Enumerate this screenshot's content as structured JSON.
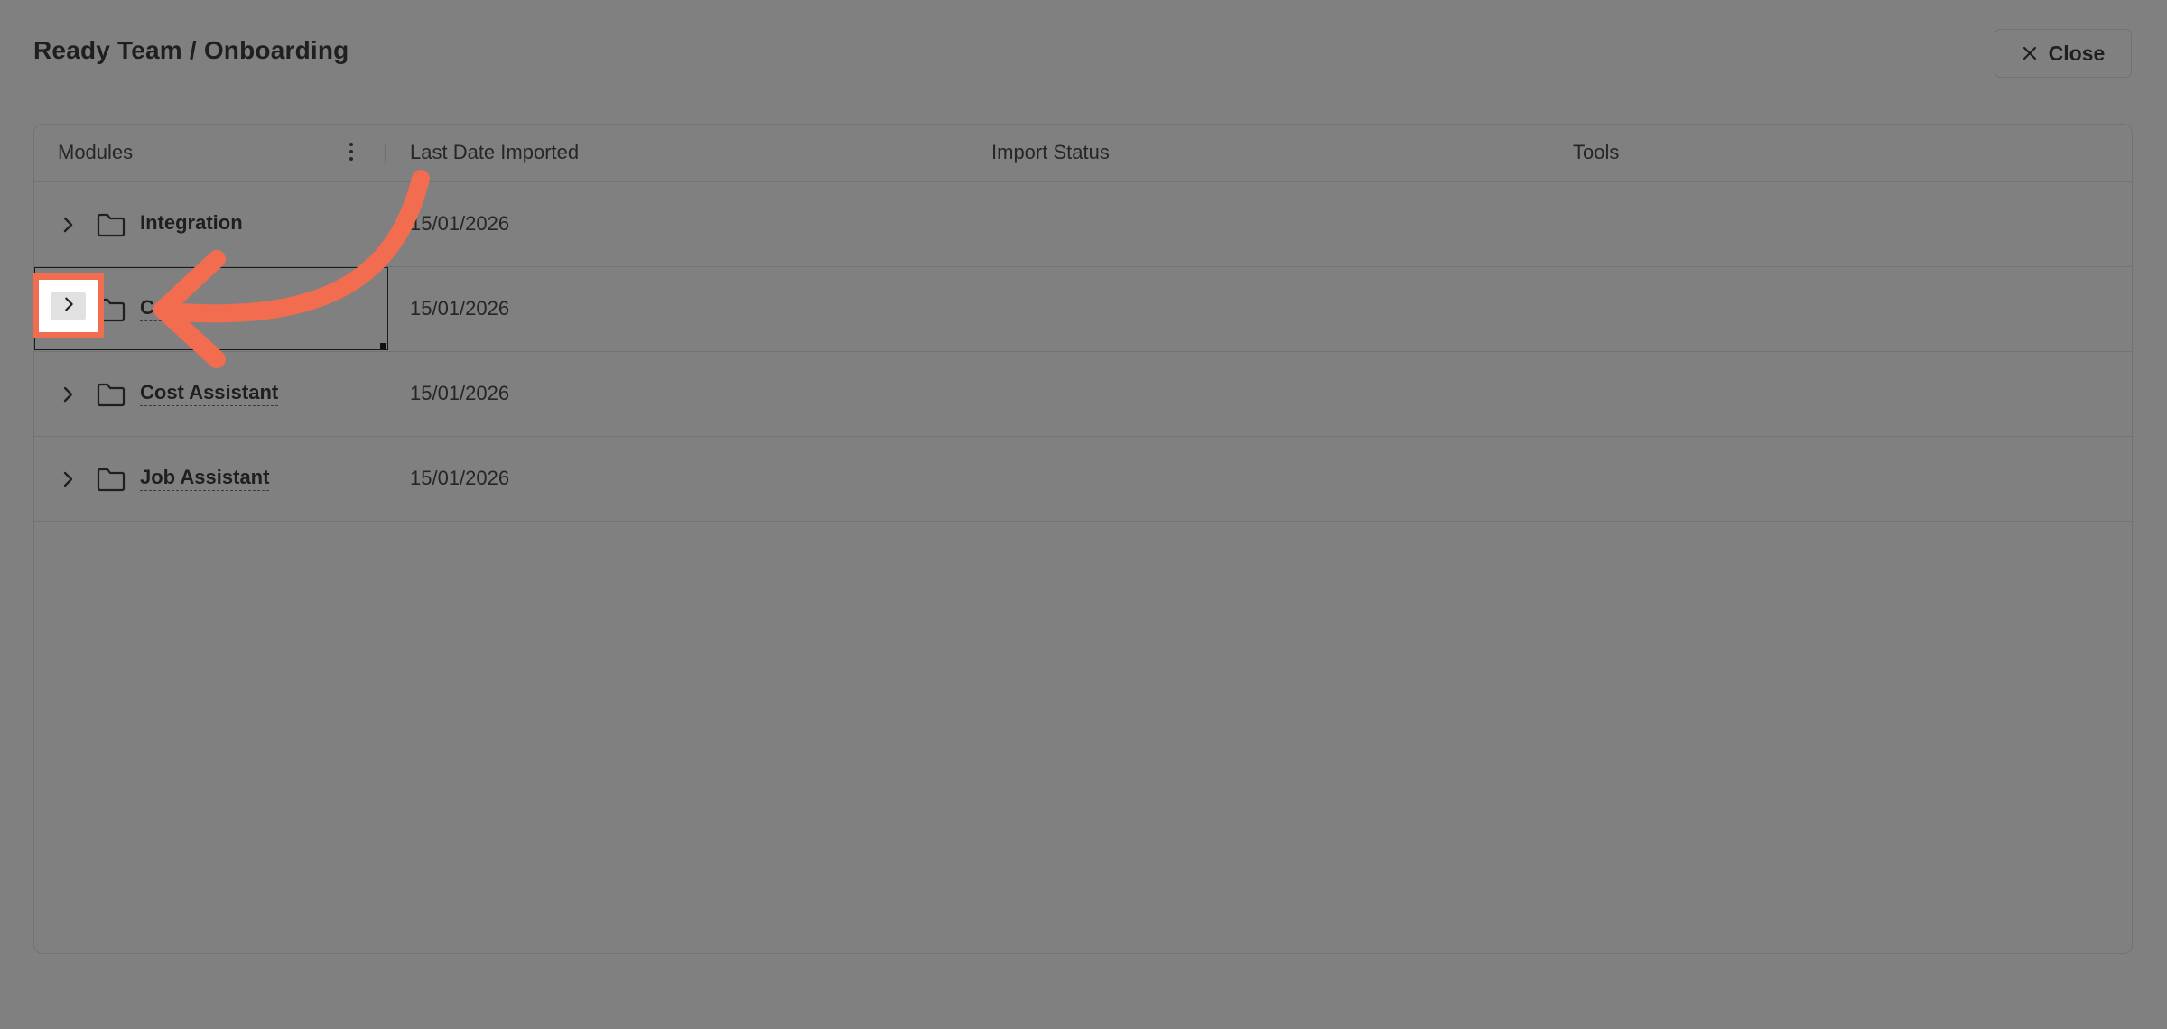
{
  "dialog": {
    "title": "Ready Team / Onboarding",
    "close_label": "Close"
  },
  "table": {
    "columns": [
      "Modules",
      "Last Date Imported",
      "Import Status",
      "Tools"
    ],
    "rows": [
      {
        "module": "Integration",
        "last_date_imported": "15/01/2026",
        "import_status": "",
        "tools": ""
      },
      {
        "module": "Co",
        "last_date_imported": "15/01/2026",
        "import_status": "",
        "tools": ""
      },
      {
        "module": "Cost Assistant",
        "last_date_imported": "15/01/2026",
        "import_status": "",
        "tools": ""
      },
      {
        "module": "Job Assistant",
        "last_date_imported": "15/01/2026",
        "import_status": "",
        "tools": ""
      }
    ]
  },
  "icons": {
    "close": "close-icon",
    "kebab": "kebab-menu-icon",
    "expand": "chevron-right-icon",
    "folder": "folder-icon"
  },
  "colors": {
    "overlay": "#808080",
    "annotation_accent": "#f26c4f",
    "highlight_fill": "#ffffff"
  }
}
